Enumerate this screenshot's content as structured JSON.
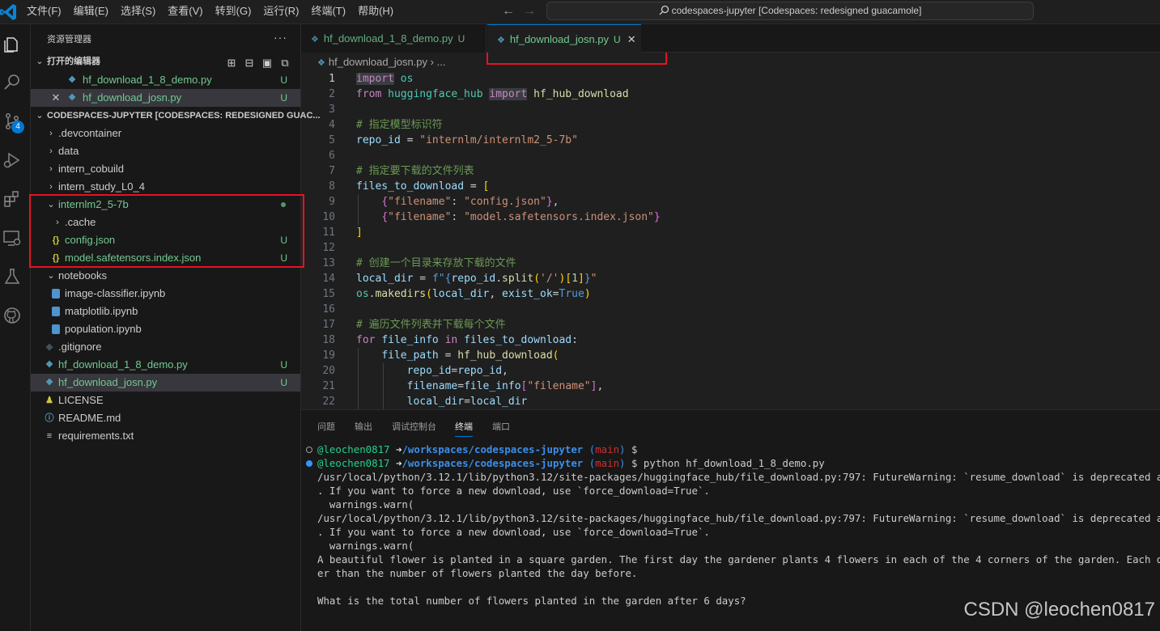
{
  "menu": [
    "文件(F)",
    "编辑(E)",
    "选择(S)",
    "查看(V)",
    "转到(G)",
    "运行(R)",
    "终端(T)",
    "帮助(H)"
  ],
  "command_center": "codespaces-jupyter [Codespaces: redesigned guacamole]",
  "activity": {
    "scm_badge": "4"
  },
  "sidebar": {
    "title": "资源管理器",
    "open_editors_title": "打开的编辑器",
    "open_editors": [
      {
        "name": "hf_download_1_8_demo.py",
        "status": "U"
      },
      {
        "name": "hf_download_josn.py",
        "status": "U"
      }
    ],
    "workspace_title": "CODESPACES-JUPYTER [CODESPACES: REDESIGNED GUAC...",
    "tree": [
      {
        "name": ".devcontainer"
      },
      {
        "name": "data"
      },
      {
        "name": "intern_cobuild"
      },
      {
        "name": "intern_study_L0_4"
      },
      {
        "name": "internlm2_5-7b"
      },
      {
        "name": ".cache"
      },
      {
        "name": "config.json",
        "status": "U"
      },
      {
        "name": "model.safetensors.index.json",
        "status": "U"
      },
      {
        "name": "notebooks"
      },
      {
        "name": "image-classifier.ipynb"
      },
      {
        "name": "matplotlib.ipynb"
      },
      {
        "name": "population.ipynb"
      },
      {
        "name": ".gitignore"
      },
      {
        "name": "hf_download_1_8_demo.py",
        "status": "U"
      },
      {
        "name": "hf_download_josn.py",
        "status": "U"
      },
      {
        "name": "LICENSE"
      },
      {
        "name": "README.md"
      },
      {
        "name": "requirements.txt"
      }
    ]
  },
  "tabs": [
    {
      "name": "hf_download_1_8_demo.py",
      "status": "U"
    },
    {
      "name": "hf_download_josn.py",
      "status": "U"
    }
  ],
  "breadcrumb": {
    "file": "hf_download_josn.py",
    "sep": "›",
    "rest": "..."
  },
  "editor": {
    "line_numbers": [
      "1",
      "2",
      "3",
      "4",
      "5",
      "6",
      "7",
      "8",
      "9",
      "10",
      "11",
      "12",
      "13",
      "14",
      "15",
      "16",
      "17",
      "18",
      "19",
      "20",
      "21",
      "22"
    ],
    "comments": {
      "c4": "# 指定模型标识符",
      "c7": "# 指定要下载的文件列表",
      "c13": "# 创建一个目录来存放下载的文件",
      "c16": "# 遍历文件列表并下载每个文件"
    },
    "strings": {
      "repo": "\"internlm/internlm2_5-7b\"",
      "filename_key": "\"filename\"",
      "config": "\"config.json\"",
      "model": "\"model.safetensors.index.json\"",
      "fstr_prefix": "f\"",
      "slash": "'/'",
      "fstr_end": "\""
    }
  },
  "panel": {
    "tabs": [
      "问题",
      "输出",
      "调试控制台",
      "终端",
      "端口"
    ],
    "prompt_user": "@leochen0817",
    "prompt_arrow": "➜",
    "prompt_path": "/workspaces/codespaces-jupyter",
    "prompt_branch": "main",
    "command": "python hf_download_1_8_demo.py",
    "output": [
      "/usr/local/python/3.12.1/lib/python3.12/site-packages/huggingface_hub/file_download.py:797: FutureWarning: `resume_download` is deprecated and will b",
      ". If you want to force a new download, use `force_download=True`.",
      "  warnings.warn(",
      "/usr/local/python/3.12.1/lib/python3.12/site-packages/huggingface_hub/file_download.py:797: FutureWarning: `resume_download` is deprecated and will b",
      ". If you want to force a new download, use `force_download=True`.",
      "  warnings.warn(",
      "A beautiful flower is planted in a square garden. The first day the gardener plants 4 flowers in each of the 4 corners of the garden. Each day therea",
      "er than the number of flowers planted the day before.",
      "",
      "What is the total number of flowers planted in the garden after 6 days?"
    ]
  },
  "watermark": "CSDN @leochen0817",
  "colors": {
    "accent": "#0078d4",
    "highlight_box": "#e81123",
    "untracked": "#73c991"
  }
}
